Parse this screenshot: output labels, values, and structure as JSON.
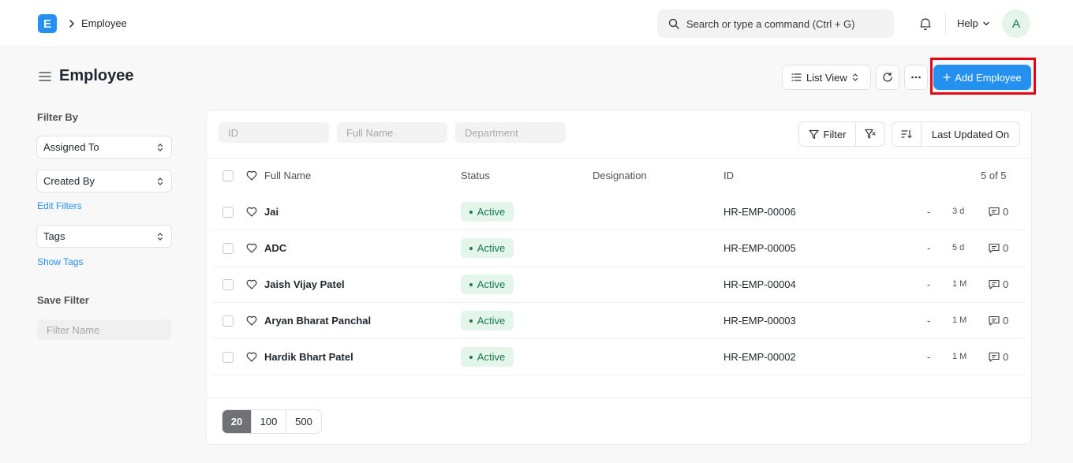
{
  "navbar": {
    "logo_letter": "E",
    "breadcrumb": "Employee",
    "search_placeholder": "Search or type a command (Ctrl + G)",
    "help_label": "Help",
    "avatar_letter": "A"
  },
  "page": {
    "title": "Employee",
    "list_view_label": "List View",
    "add_button_label": "Add Employee"
  },
  "sidebar": {
    "filter_by_label": "Filter By",
    "assigned_to_label": "Assigned To",
    "created_by_label": "Created By",
    "edit_filters_label": "Edit Filters",
    "tags_label": "Tags",
    "show_tags_label": "Show Tags",
    "save_filter_label": "Save Filter",
    "filter_name_placeholder": "Filter Name"
  },
  "filters": {
    "id_placeholder": "ID",
    "full_name_placeholder": "Full Name",
    "department_placeholder": "Department",
    "filter_label": "Filter",
    "sort_label": "Last Updated On"
  },
  "table": {
    "headers": {
      "full_name": "Full Name",
      "status": "Status",
      "designation": "Designation",
      "id": "ID",
      "count": "5 of 5"
    },
    "rows": [
      {
        "name": "Jai",
        "status": "Active",
        "id": "HR-EMP-00006",
        "dash": "-",
        "time": "3 d",
        "comments": "0"
      },
      {
        "name": "ADC",
        "status": "Active",
        "id": "HR-EMP-00005",
        "dash": "-",
        "time": "5 d",
        "comments": "0"
      },
      {
        "name": "Jaish Vijay Patel",
        "status": "Active",
        "id": "HR-EMP-00004",
        "dash": "-",
        "time": "1 M",
        "comments": "0"
      },
      {
        "name": "Aryan Bharat Panchal",
        "status": "Active",
        "id": "HR-EMP-00003",
        "dash": "-",
        "time": "1 M",
        "comments": "0"
      },
      {
        "name": "Hardik Bhart Patel",
        "status": "Active",
        "id": "HR-EMP-00002",
        "dash": "-",
        "time": "1 M",
        "comments": "0"
      }
    ]
  },
  "pager": {
    "sizes": [
      "20",
      "100",
      "500"
    ]
  },
  "colors": {
    "primary": "#2490ef",
    "status_active_bg": "#e4f5e9",
    "status_active_text": "#16794c",
    "highlight": "#e30613"
  }
}
